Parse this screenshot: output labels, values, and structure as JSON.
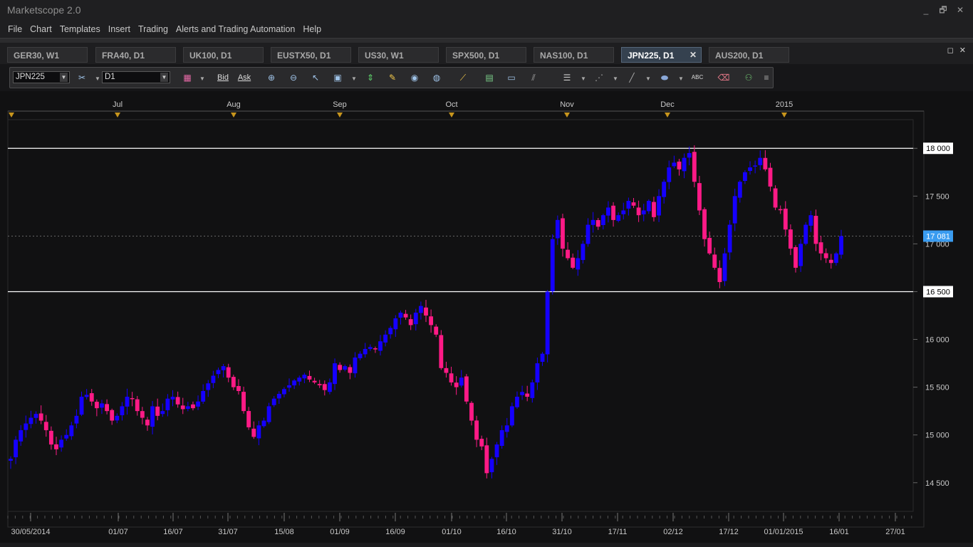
{
  "app": {
    "title": "Marketscope 2.0"
  },
  "window_controls": [
    "_",
    "🗗",
    "✕"
  ],
  "menu": [
    "File",
    "Chart",
    "Templates",
    "Insert",
    "Trading",
    "Alerts and Trading Automation",
    "Help"
  ],
  "tabs": [
    {
      "label": "GER30, W1",
      "active": false
    },
    {
      "label": "FRA40, D1",
      "active": false
    },
    {
      "label": "UK100, D1",
      "active": false
    },
    {
      "label": "EUSTX50, D1",
      "active": false
    },
    {
      "label": "US30, W1",
      "active": false
    },
    {
      "label": "SPX500, D1",
      "active": false
    },
    {
      "label": "NAS100, D1",
      "active": false
    },
    {
      "label": "JPN225, D1",
      "active": true,
      "close": "✕"
    },
    {
      "label": "AUS200, D1",
      "active": false
    }
  ],
  "tab_controls": [
    "◻",
    "✕"
  ],
  "toolbar": {
    "instrument": "JPN225",
    "timeframe": "D1",
    "bid_label": "Bid",
    "ask_label": "Ask",
    "icons": [
      "crosshair-icon",
      "zoom-in-icon",
      "zoom-out-icon",
      "cursor-icon",
      "pan-icon",
      "trend-icon",
      "scroll-icon",
      "edit-icon",
      "eye-icon",
      "globe-icon",
      "ruler-icon",
      "picture-icon",
      "window-icon",
      "pitchfork-icon",
      "lines-icon",
      "fan-icon",
      "pencil-icon",
      "ellipse-icon",
      "text-icon",
      "eraser-icon",
      "network-icon",
      "more-icon"
    ]
  },
  "colors": {
    "bull": "#1500ff",
    "bear": "#ff1a86",
    "background": "#111112",
    "line": "#ffffff",
    "current_price": "#3a9cf0"
  },
  "chart_data": {
    "type": "candlestick",
    "instrument": "JPN225",
    "timeframe": "D1",
    "top_month_labels": [
      "Jul",
      "Aug",
      "Sep",
      "Oct",
      "Nov",
      "Dec",
      "2015"
    ],
    "x_tick_labels": [
      "30/05/2014",
      "01/07",
      "16/07",
      "31/07",
      "15/08",
      "01/09",
      "16/09",
      "01/10",
      "16/10",
      "31/10",
      "17/11",
      "02/12",
      "17/12",
      "01/01/2015",
      "16/01",
      "27/01"
    ],
    "y_tick_labels": [
      "18 000",
      "17 500",
      "17 000",
      "16 500",
      "16 000",
      "15 500",
      "15 000",
      "14 500"
    ],
    "y_ticks": [
      18000,
      17500,
      17000,
      16500,
      16000,
      15500,
      15000,
      14500
    ],
    "ylim": [
      14200,
      18300
    ],
    "horizontal_lines": [
      {
        "value": 18000,
        "label": "18 000"
      },
      {
        "value": 16500,
        "label": "16 500"
      }
    ],
    "current_price": {
      "value": 17081,
      "label": "17 081"
    },
    "closes": [
      14750,
      14950,
      15050,
      15120,
      15180,
      15220,
      15150,
      15050,
      14900,
      14850,
      14950,
      15000,
      15100,
      15200,
      15400,
      15420,
      15350,
      15280,
      15330,
      15250,
      15150,
      15200,
      15300,
      15400,
      15380,
      15250,
      15180,
      15100,
      15300,
      15200,
      15250,
      15380,
      15400,
      15320,
      15270,
      15300,
      15280,
      15350,
      15460,
      15540,
      15620,
      15680,
      15720,
      15600,
      15500,
      15460,
      15250,
      15080,
      14980,
      15100,
      15150,
      15300,
      15380,
      15430,
      15480,
      15520,
      15570,
      15600,
      15630,
      15580,
      15550,
      15520,
      15470,
      15550,
      15750,
      15680,
      15720,
      15650,
      15810,
      15850,
      15900,
      15920,
      15900,
      15980,
      16050,
      16120,
      16220,
      16280,
      16230,
      16150,
      16280,
      16350,
      16250,
      16150,
      16050,
      15700,
      15650,
      15550,
      15500,
      15600,
      15350,
      15150,
      14950,
      14880,
      14600,
      14750,
      14900,
      15050,
      15100,
      15300,
      15400,
      15450,
      15400,
      15550,
      15750,
      15850,
      16500,
      17050,
      17250,
      16950,
      16850,
      16750,
      16850,
      17000,
      17200,
      17250,
      17180,
      17300,
      17380,
      17250,
      17300,
      17350,
      17450,
      17400,
      17300,
      17350,
      17450,
      17280,
      17500,
      17650,
      17800,
      17850,
      17780,
      17900,
      17950,
      17650,
      17350,
      17050,
      16900,
      16750,
      16600,
      16900,
      17200,
      17500,
      17650,
      17750,
      17800,
      17820,
      17900,
      17780,
      17600,
      17380,
      17360,
      17150,
      16950,
      16750,
      17000,
      17200,
      17300,
      17000,
      16900,
      16850,
      16800,
      16900,
      17081
    ]
  }
}
